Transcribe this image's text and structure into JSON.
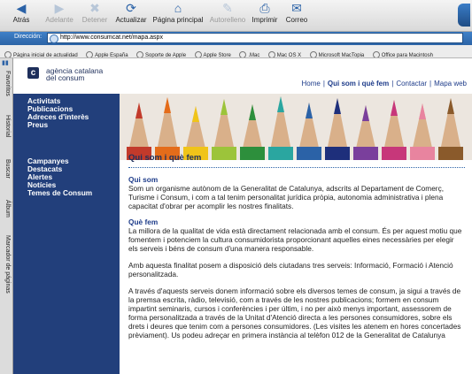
{
  "browser": {
    "toolbar": [
      {
        "name": "back-button",
        "icon": "back-icon",
        "label": "Atrás",
        "dim": false
      },
      {
        "name": "forward-button",
        "icon": "forward-icon",
        "label": "Adelante",
        "dim": true
      },
      {
        "name": "stop-button",
        "icon": "stop-icon",
        "label": "Detener",
        "dim": true
      },
      {
        "name": "refresh-button",
        "icon": "refresh-icon",
        "label": "Actualizar",
        "dim": false
      },
      {
        "name": "home-button",
        "icon": "home-icon",
        "label": "Página principal",
        "dim": false
      },
      {
        "name": "autofill-button",
        "icon": "autofill-icon",
        "label": "Autorelleno",
        "dim": true
      },
      {
        "name": "print-button",
        "icon": "print-icon",
        "label": "Imprimir",
        "dim": false
      },
      {
        "name": "mail-button",
        "icon": "mail-icon",
        "label": "Correo",
        "dim": false
      }
    ],
    "address_label": "Dirección:",
    "url": "http://www.consumcat.net/mapa.aspx",
    "favorites": [
      "Página inicial de actualidad",
      "Apple España",
      "Soporte de Apple",
      "Apple Store",
      ".Mac",
      "Mac OS X",
      "Microsoft MacTopia",
      "Office para Macintosh"
    ],
    "side_tabs": [
      "Favoritos",
      "Historial",
      "Buscar",
      "Álbum",
      "Marcador de páginas"
    ]
  },
  "site": {
    "logo_mark": "c",
    "logo_line1": "agència catalana",
    "logo_line2": "del consum",
    "topnav": [
      "Home",
      "Qui som i què fem",
      "Contactar",
      "Mapa web"
    ],
    "leftnav_group1": [
      "Activitats",
      "Publicacions",
      "Adreces d'interès",
      "Preus"
    ],
    "leftnav_group2": [
      "Campanyes",
      "Destacats",
      "Alertes",
      "Notícies",
      "Temes de Consum"
    ]
  },
  "content": {
    "title": "Qui som i què fem",
    "sec1_title": "Qui som",
    "sec1_text": "Som un organisme autònom de la Generalitat de Catalunya, adscrits al Departament de Comerç, Turisme i Consum, i com a tal tenim personalitat jurídica pròpia, autonomia administrativa i plena capacitat d'obrar per acomplir les nostres finalitats.",
    "sec2_title": "Què fem",
    "sec2_text": "La millora de la qualitat de vida està directament relacionada amb el consum. És per aquest motiu que fomentem i potenciem la cultura consumidorista proporcionant aquelles eines necessàries per elegir els serveis i béns de consum d'una manera responsable.",
    "para3": "Amb aquesta finalitat posem a disposició dels ciutadans tres serveis: Informació, Formació i Atenció personalitzada.",
    "para4": "A través d'aquests serveis donem informació sobre els diversos temes de consum, ja sigui a través de la premsa escrita, ràdio, televisió, com a través de les nostres publicacions; formem en consum impartint seminaris, cursos i conferències i per últim, i no per això menys important, assessorem de forma personalitzada a través de la Unitat d'Atenció directa a les persones consumidores, sobre els drets i deures que tenim com a persones consumidores. (Les visites les atenem en hores concertades prèviament). Us podeu adreçar en primera instància al telèfon 012 de la Generalitat de Catalunya"
  },
  "colors": {
    "nav_blue": "#223f7b",
    "link_blue": "#1e3c8a",
    "address_blue": "#2c64a6"
  }
}
